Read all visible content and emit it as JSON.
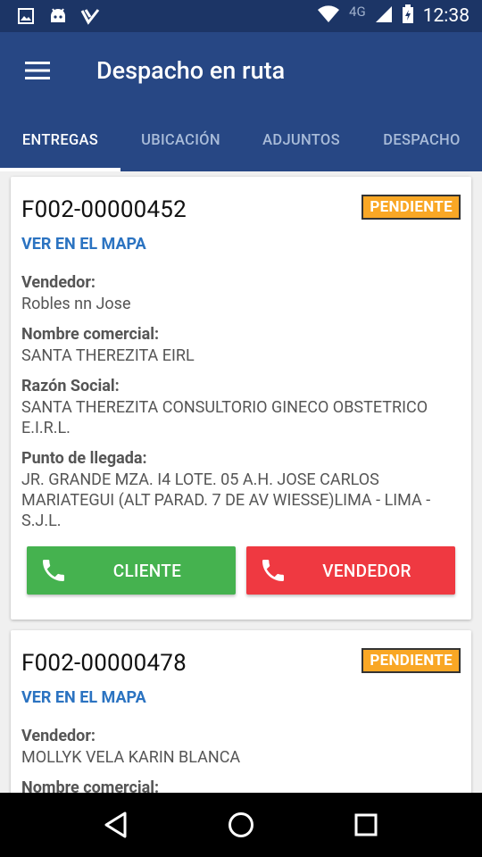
{
  "status_bar": {
    "network": "4G",
    "time": "12:38",
    "icons": [
      "image-icon",
      "android-icon",
      "checkmark-icon",
      "wifi-icon",
      "signal-icon",
      "battery-charging-icon"
    ]
  },
  "app_bar": {
    "title": "Despacho en ruta",
    "menu_icon": "hamburger-menu-icon"
  },
  "tabs": [
    {
      "label": "ENTREGAS",
      "active": true
    },
    {
      "label": "UBICACIÓN",
      "active": false
    },
    {
      "label": "ADJUNTOS",
      "active": false
    },
    {
      "label": "DESPACHO",
      "active": false
    }
  ],
  "deliveries": [
    {
      "id": "F002-00000452",
      "status": "PENDIENTE",
      "map_link": "VER EN EL MAPA",
      "fields": [
        {
          "label": "Vendedor:",
          "value": "Robles nn Jose"
        },
        {
          "label": "Nombre comercial:",
          "value": "SANTA THEREZITA EIRL"
        },
        {
          "label": "Razón Social:",
          "value": "SANTA THEREZITA CONSULTORIO GINECO OBSTETRICO E.I.R.L."
        },
        {
          "label": "Punto de llegada:",
          "value": "JR. GRANDE MZA. I4 LOTE. 05 A.H. JOSE CARLOS MARIATEGUI (ALT PARAD. 7 DE AV WIESSE)LIMA - LIMA - S.J.L."
        }
      ],
      "buttons": {
        "client": "CLIENTE",
        "seller": "VENDEDOR"
      }
    },
    {
      "id": "F002-00000478",
      "status": "PENDIENTE",
      "map_link": "VER EN EL MAPA",
      "fields": [
        {
          "label": "Vendedor:",
          "value": "MOLLYK VELA KARIN BLANCA"
        },
        {
          "label": "Nombre comercial:",
          "value": ""
        }
      ]
    }
  ],
  "colors": {
    "status_bar": "#1c3566",
    "app_bar": "#274784",
    "badge": "#f9a725",
    "link": "#2b73c1",
    "client_button": "#45b24f",
    "seller_button": "#ef3941"
  },
  "nav_bar": {
    "icons": [
      "back-icon",
      "home-icon",
      "recents-icon"
    ]
  }
}
